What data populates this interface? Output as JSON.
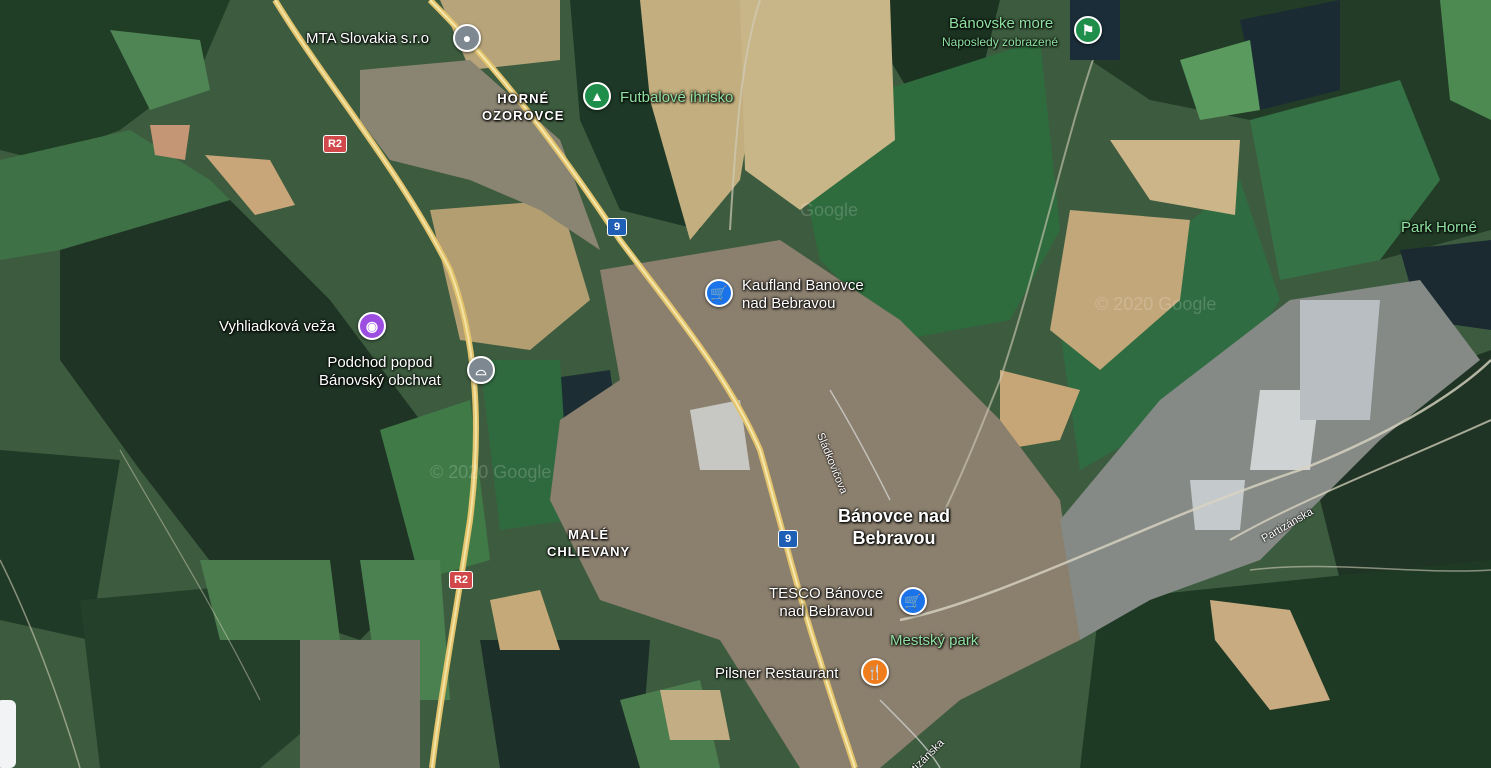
{
  "map_labels": {
    "mta": "MTA Slovakia s.r.o",
    "horne_ozorovce": "HORNÉ\nOZOROVCE",
    "futbal": "Futbalové ihrisko",
    "banovske_more": "Bánovske more",
    "naposledy": "Naposledy zobrazené",
    "park_horne": "Park Horné",
    "kaufland": "Kaufland Banovce\nnad Bebravou",
    "vyhliadkova": "Vyhliadková veža",
    "podchod": "Podchod popod\nBánovský obchvat",
    "sladkovicova": "Sládkovičova",
    "banovce": "Bánovce nad\nBebravou",
    "male_chlievany": "MALÉ\nCHLIEVANY",
    "tesco": "TESCO Bánovce\nnad Bebravou",
    "mestsky_park": "Mestský park",
    "pilsner": "Pilsner Restaurant",
    "partizanska": "Partizánska",
    "partizanska2": "rtizánska"
  },
  "shields": {
    "r2": "R2",
    "road9": "9"
  },
  "watermarks": [
    "© 2020 Google",
    "Google",
    "© 2020 Google"
  ],
  "icons": {
    "mta": "place-pin-icon",
    "futbal": "tree-park-icon",
    "banovske_more": "hiking-icon",
    "kaufland": "shopping-cart-icon",
    "vyhliadkova": "camera-icon",
    "podchod": "bridge-icon",
    "tesco": "shopping-cart-icon",
    "pilsner": "restaurant-icon"
  },
  "colors": {
    "pin_gray": "#7d8890",
    "pin_green": "#1e8e4a",
    "pin_purple": "#9b4ee0",
    "pin_blue": "#1a73e8",
    "pin_orange": "#f07d1b",
    "shield_red": "#d2484a",
    "shield_blue": "#1f5fb6",
    "park_label": "#8fe0a0"
  }
}
